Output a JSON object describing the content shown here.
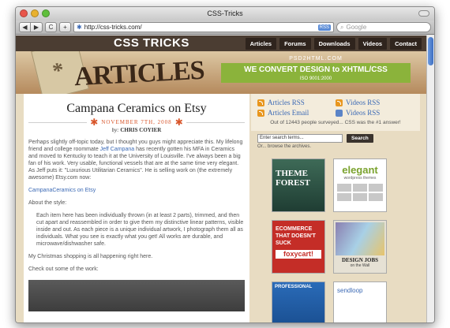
{
  "browser": {
    "window_title": "CSS-Tricks",
    "url": "http://css-tricks.com/",
    "rss_badge": "RSS",
    "search_placeholder": "Google",
    "buttons": {
      "back": "◀",
      "forward": "▶",
      "reload": "C",
      "add": "+"
    }
  },
  "site": {
    "logo": "CSS TRICKS",
    "nav": [
      "Articles",
      "Forums",
      "Downloads",
      "Videos",
      "Contact"
    ],
    "banner_title": "ARTICLES",
    "ad": {
      "top": "PSD2HTML.COM",
      "main": "WE CONVERT DESIGN to XHTML/CSS",
      "iso": "ISO 9001:2000"
    }
  },
  "post": {
    "title": "Campana Ceramics on Etsy",
    "date": "NOVEMBER 7TH, 2008",
    "by_label": "by:",
    "author": "CHRIS COYIER",
    "p1_a": "Perhaps slightly off-topic today, but I thought you guys might appreciate this. My lifelong friend and college roommate ",
    "p1_link": "Jeff Campana",
    "p1_b": " has recently gotten his MFA in Ceramics and moved to Kentucky to teach it at the University of Louisville. I've always been a big fan of his work. Very usable, functional vessels that are at the same time very elegant. As Jeff puts it: \"Luxurious Utilitarian Ceramics\". He is selling work on (the extremely awesome) Etsy.com now:",
    "shop_link": "CampanaCeramics on Etsy",
    "p2": "About the style:",
    "quote": "Each item here has been individually thrown (in at least 2 parts), trimmed, and then cut apart and reassembled in order to give them my distinctive linear patterns, visible inside and out. As each piece is a unique individual artwork, I photograph them all as individuals. What you see is exactly what you get! All works are durable, and microwave/dishwasher safe.",
    "p3": "My Christmas shopping is all happening right here.",
    "p4": "Check out some of the work:"
  },
  "sidebar": {
    "subs": [
      "Articles RSS",
      "Videos RSS",
      "Articles Email",
      "Videos RSS"
    ],
    "survey": "Out of 12443 people surveyed... CSS was the #1 answer!",
    "search_value": "Enter search terms...",
    "search_button": "Search",
    "browse": "Or... browse the archives.",
    "ads": {
      "t1": "THEME FOREST",
      "t2_title": "elegant",
      "t2_sub": "wordpress themes",
      "t3_text": "ECOMMERCE THAT DOESN'T SUCK",
      "t3_brand": "foxycart!",
      "t4_title": "DESIGN JOBS",
      "t4_sub": "on the Wall",
      "t5": "PROFESSIONAL",
      "t6": "sendloop"
    }
  }
}
